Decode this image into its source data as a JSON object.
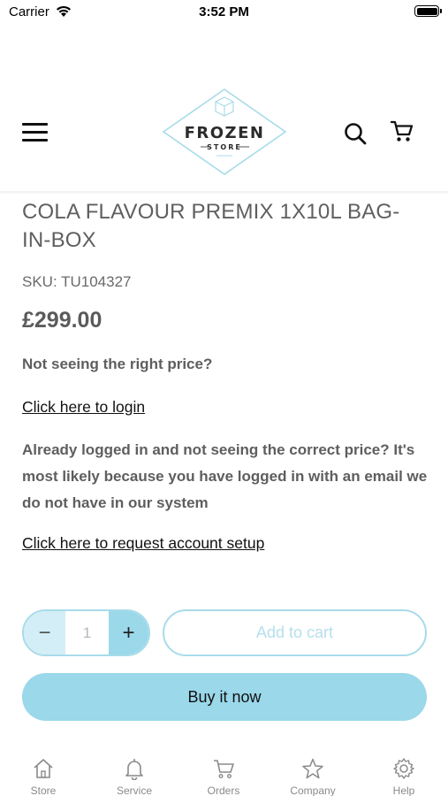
{
  "status_bar": {
    "carrier": "Carrier",
    "time": "3:52 PM",
    "icons": [
      "wifi-icon",
      "battery-icon"
    ]
  },
  "header": {
    "menu_icon": "hamburger-menu-icon",
    "logo": {
      "line1": "FROZEN",
      "line2": "STORE"
    },
    "search_icon": "search-icon",
    "cart_icon": "cart-icon"
  },
  "product": {
    "title": "COLA FLAVOUR PREMIX 1X10L BAG-IN-BOX",
    "sku": "SKU: TU104327",
    "price": "£299.00",
    "price_question": "Not seeing the right price?",
    "login_link": "Click here to login",
    "logged_in_text": "Already logged in and not seeing the correct price? It's most likely because you have logged in with an email we do not have in our system",
    "setup_link": "Click here to request account setup"
  },
  "purchase": {
    "quantity": "1",
    "minus": "−",
    "plus": "+",
    "add_to_cart": "Add to cart",
    "buy_now": "Buy it now"
  },
  "tabbar": {
    "items": [
      {
        "label": "Store",
        "icon": "home-icon"
      },
      {
        "label": "Service",
        "icon": "bell-icon"
      },
      {
        "label": "Orders",
        "icon": "cart-icon"
      },
      {
        "label": "Company",
        "icon": "star-icon"
      },
      {
        "label": "Help",
        "icon": "gear-icon"
      }
    ]
  },
  "colors": {
    "accent": "#9ad8ea",
    "accent_light": "#d3eef6",
    "text": "#5b5b5b",
    "link": "#111111"
  }
}
